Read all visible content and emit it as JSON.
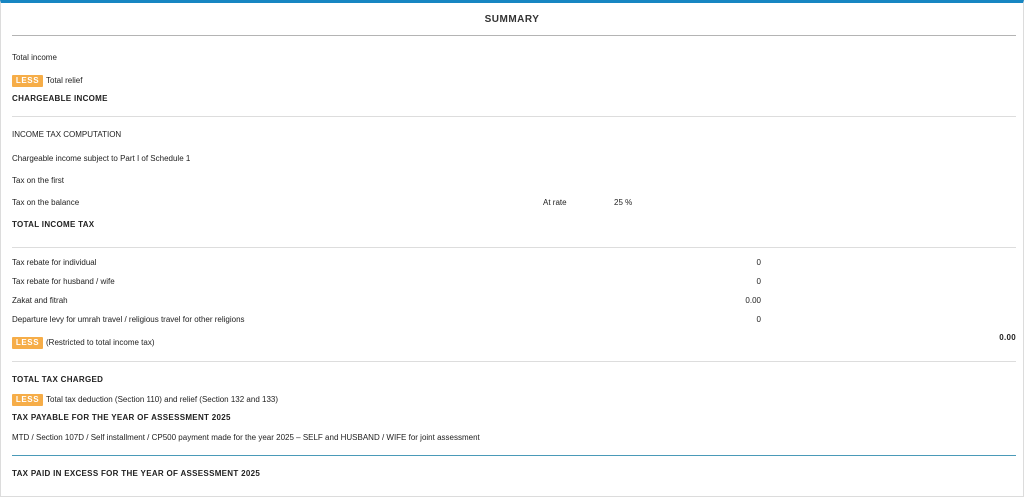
{
  "summary": {
    "title": "SUMMARY",
    "less_label": "LESS",
    "total_income": "Total income",
    "total_relief": "Total relief",
    "chargeable_income": "CHARGEABLE INCOME"
  },
  "computation": {
    "heading": "INCOME TAX COMPUTATION",
    "chargeable_subject": "Chargeable income subject to Part I of Schedule 1",
    "tax_first": "Tax on the first",
    "tax_balance": "Tax on the balance",
    "at_rate_label": "At rate",
    "rate_value": "25 %",
    "total_income_tax": "TOTAL INCOME TAX"
  },
  "rebates": {
    "individual_label": "Tax rebate for individual",
    "individual_value": "0",
    "spouse_label": "Tax rebate for husband / wife",
    "spouse_value": "0",
    "zakat_label": "Zakat and fitrah",
    "zakat_value": "0.00",
    "levy_label": "Departure levy for umrah travel / religious travel for other religions",
    "levy_value": "0",
    "restricted_label": "(Restricted to total income tax)",
    "restricted_total": "0.00"
  },
  "charged": {
    "total_tax_charged": "TOTAL TAX CHARGED",
    "deduction_label": "Total tax deduction (Section 110) and relief (Section 132 and 133)",
    "tax_payable": "TAX PAYABLE FOR THE YEAR OF ASSESSMENT 2025",
    "mtd_label": "MTD / Section 107D / Self installment / CP500 payment made for the year 2025 – SELF and HUSBAND / WIFE for joint assessment",
    "tax_excess": "TAX PAID IN EXCESS FOR THE YEAR OF ASSESSMENT 2025"
  }
}
